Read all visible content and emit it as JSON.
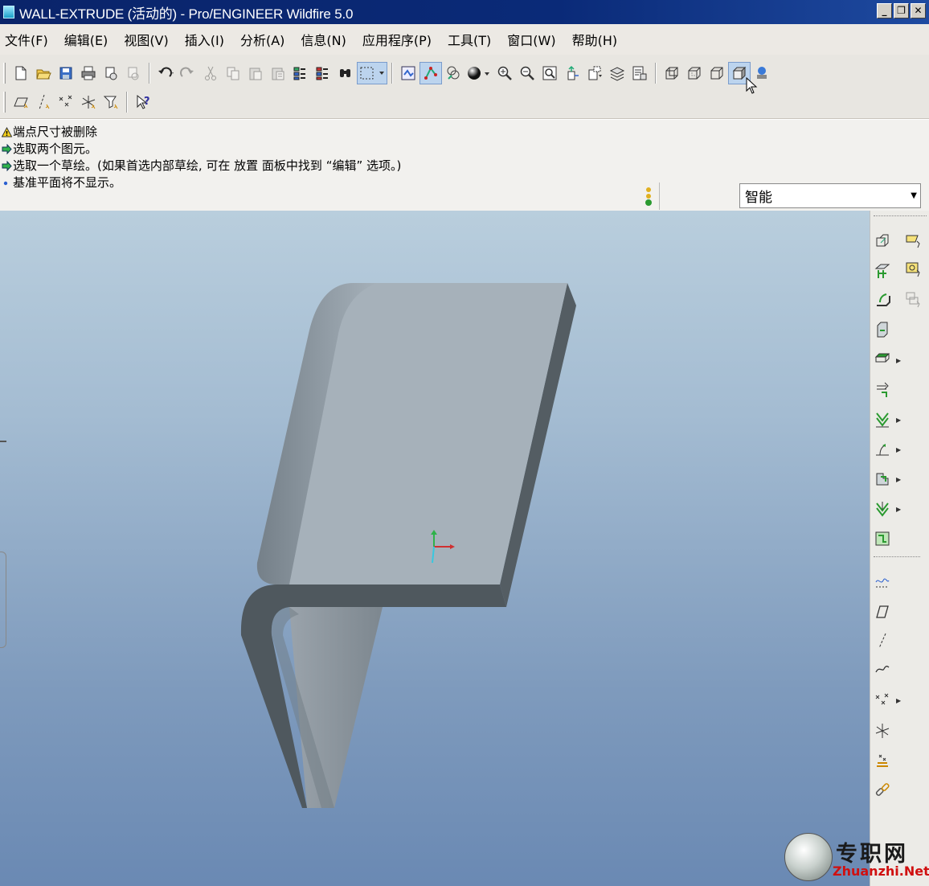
{
  "window": {
    "title": "WALL-EXTRUDE (活动的) - Pro/ENGINEER Wildfire 5.0",
    "buttons": {
      "minimize": "_",
      "restore": "❐",
      "close": "✕"
    }
  },
  "menubar": {
    "items": [
      "文件(F)",
      "编辑(E)",
      "视图(V)",
      "插入(I)",
      "分析(A)",
      "信息(N)",
      "应用程序(P)",
      "工具(T)",
      "窗口(W)",
      "帮助(H)"
    ]
  },
  "toolbar1": {
    "icons": [
      "new-file-icon",
      "open-file-icon",
      "save-icon",
      "print-icon",
      "email-icon",
      "email-link-icon",
      "undo-icon",
      "redo-icon",
      "cut-icon",
      "copy-icon",
      "paste-icon",
      "paste-special-icon",
      "regenerate-icon",
      "regen-manager-icon",
      "find-icon",
      "select-box-icon",
      "view-manager-icon",
      "datum-display-icon",
      "layers-icon",
      "shading-sphere-icon",
      "zoom-in-icon",
      "zoom-out-icon",
      "refit-icon",
      "orient-icon",
      "saved-views-icon",
      "layer-tree-icon",
      "setup-display-icon",
      "wireframe-icon",
      "hidden-line-icon",
      "no-hidden-icon",
      "shaded-icon",
      "appearance-icon"
    ]
  },
  "toolbar2": {
    "icons": [
      "datum-plane-display-icon",
      "datum-axis-display-icon",
      "point-display-icon",
      "csys-display-icon",
      "annotation-display-icon",
      "context-help-icon"
    ]
  },
  "messages": [
    {
      "type": "warning",
      "text": "端点尺寸被删除"
    },
    {
      "type": "prompt",
      "text": "选取两个图元。"
    },
    {
      "type": "prompt",
      "text": "选取一个草绘。(如果首选内部草绘, 可在 放置 面板中找到 “编辑” 选项。)"
    },
    {
      "type": "info",
      "text": "基准平面将不显示。"
    }
  ],
  "filter": {
    "value": "智能"
  },
  "colors": {
    "titlebar": "#0a246a",
    "part_face": "#a6b1ba",
    "part_side": "#515a60",
    "viewport_top": "#b9cedd",
    "viewport_bottom": "#6a89b3"
  },
  "rightbar": {
    "main_icons": [
      "sheetmetal-convert-icon",
      "flat-wall-icon",
      "flange-wall-icon",
      "unattached-wall-icon",
      "extrude-wall-icon",
      "rip-icon",
      "merge-icon",
      "bend-icon",
      "edge-bend-icon",
      "unbend-icon",
      "bend-back-icon"
    ],
    "side_icons": [
      "flat-pattern-icon",
      "form-icon",
      "flatten-form-icon"
    ],
    "datum_icons": [
      "datum-curve-sketch-icon",
      "datum-plane-icon",
      "datum-axis-icon",
      "datum-curve-icon",
      "datum-point-icon",
      "csys-icon",
      "analysis-feature-icon",
      "chain-link-icon"
    ]
  },
  "watermark": {
    "chinese": "专职网",
    "english": "Zhuanzhi.Net"
  }
}
